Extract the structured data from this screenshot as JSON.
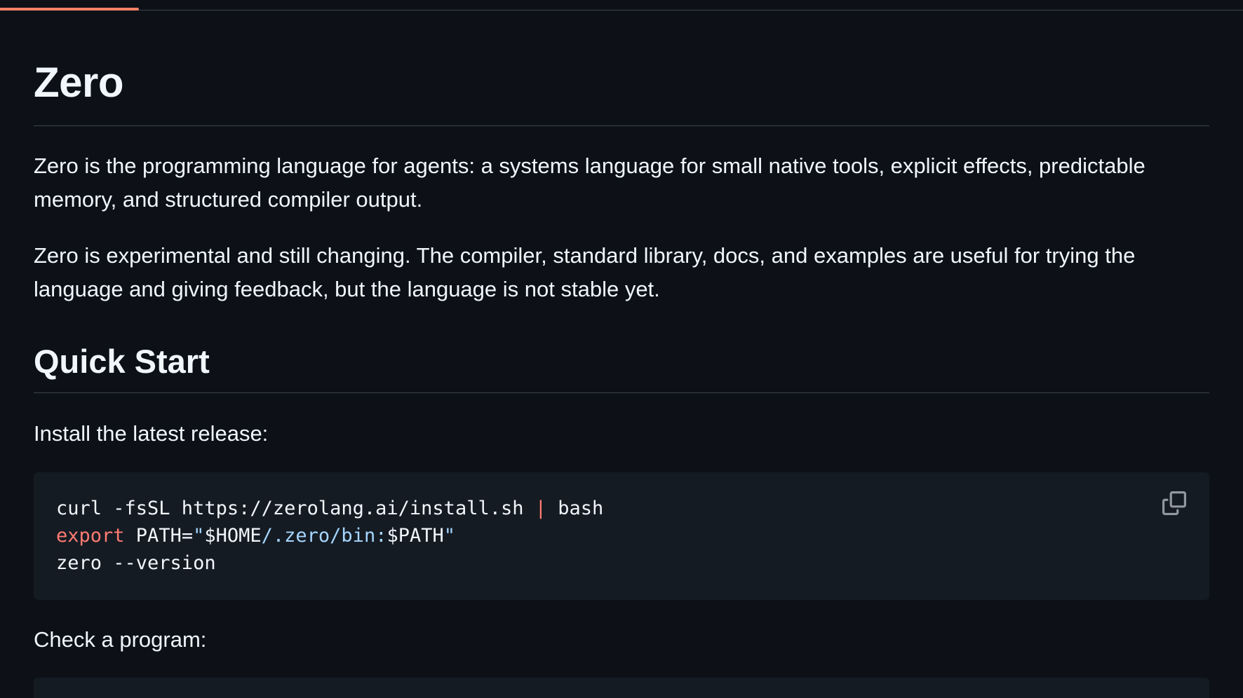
{
  "readme": {
    "title": "Zero",
    "intro": "Zero is the programming language for agents: a systems language for small native tools, explicit effects, predictable memory, and structured compiler output.",
    "status": "Zero is experimental and still changing. The compiler, standard library, docs, and examples are useful for trying the language and giving feedback, but the language is not stable yet.",
    "quick_start": {
      "heading": "Quick Start",
      "install_label": "Install the latest release:",
      "install_code": {
        "line1": {
          "cmd": "curl -fsSL https://zerolang.ai/install.sh ",
          "pipe": "|",
          "rest": " bash"
        },
        "line2": {
          "keyword": "export",
          "assign": " PATH=",
          "quote_open": "\"",
          "var_home": "$HOME",
          "path_mid": "/.zero/bin:",
          "var_path": "$PATH",
          "quote_close": "\""
        },
        "line3": "zero --version"
      },
      "copy_icon": "copy-icon",
      "check_label": "Check a program:"
    }
  },
  "colors": {
    "background": "#0d1117",
    "code_background": "#151b23",
    "text": "#f0f6fc",
    "rule": "#3d444d",
    "active_tab": "#f78166",
    "keyword": "#ff7b72",
    "string": "#a5d6ff"
  }
}
